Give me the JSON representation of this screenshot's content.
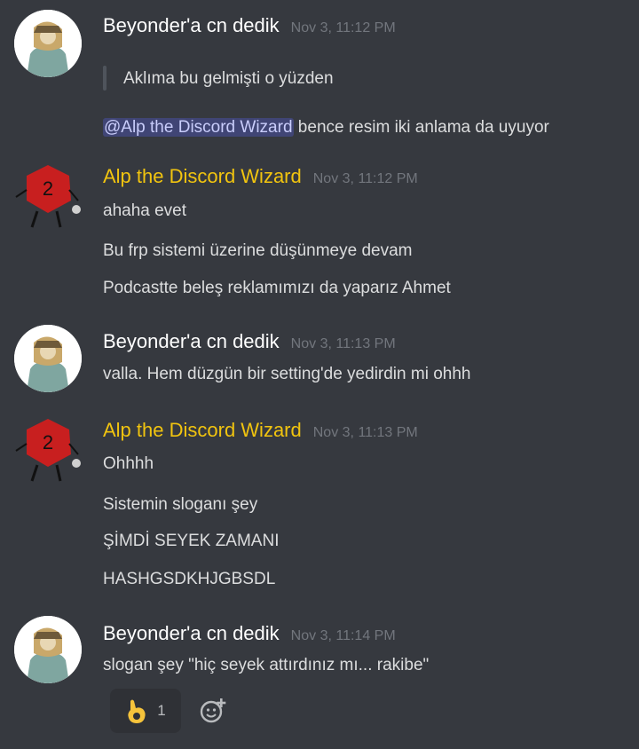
{
  "messages": [
    {
      "author": "Beyonder'a cn dedik",
      "time": "Nov 3, 11:12 PM",
      "quote": "Aklıma bu gelmişti o yüzden",
      "mention": "@Alp the Discord Wizard",
      "mention_rest": " bence resim iki anlama da uyuyor"
    },
    {
      "author": "Alp the Discord Wizard",
      "time": "Nov 3, 11:12 PM",
      "lines": [
        "ahaha evet",
        "Bu frp sistemi üzerine düşünmeye devam",
        "Podcastte beleş reklamımızı da yaparız Ahmet"
      ]
    },
    {
      "author": "Beyonder'a cn dedik",
      "time": "Nov 3, 11:13 PM",
      "lines": [
        "valla. Hem düzgün bir setting'de yedirdin mi ohhh"
      ]
    },
    {
      "author": "Alp the Discord Wizard",
      "time": "Nov 3, 11:13 PM",
      "lines": [
        "Ohhhh",
        "Sistemin sloganı şey",
        "ŞİMDİ SEYEK ZAMANI",
        "HASHGSDKHJGBSDL"
      ]
    },
    {
      "author": "Beyonder'a cn dedik",
      "time": "Nov 3, 11:14 PM",
      "lines": [
        "slogan şey \"hiç seyek attırdınız mı... rakibe\""
      ],
      "reaction": {
        "icon": "ok-hand-icon",
        "count": "1"
      }
    }
  ],
  "colors": {
    "background": "#36393f",
    "wizard_name": "#f1c40f",
    "timestamp": "#72767d"
  }
}
